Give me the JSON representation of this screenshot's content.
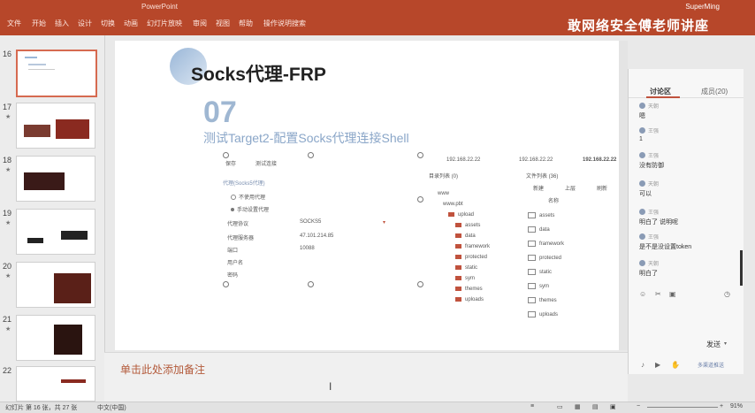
{
  "app": {
    "title_text": "PowerPoint",
    "user_text": "SuperMing"
  },
  "watermark": "敢网络安全傅老师讲座",
  "ribbon": {
    "tabs": [
      "文件",
      "开始",
      "插入",
      "设计",
      "切换",
      "动画",
      "幻灯片放映",
      "审阅",
      "视图",
      "帮助",
      "操作说明搜索"
    ]
  },
  "thumbnails": [
    {
      "num": "16",
      "star": "",
      "active": true
    },
    {
      "num": "17",
      "star": "★",
      "active": false
    },
    {
      "num": "18",
      "star": "★",
      "active": false
    },
    {
      "num": "19",
      "star": "★",
      "active": false
    },
    {
      "num": "20",
      "star": "★",
      "active": false
    },
    {
      "num": "21",
      "star": "★",
      "active": false
    },
    {
      "num": "22",
      "star": "",
      "active": false
    }
  ],
  "slide": {
    "title": "Socks代理-FRP",
    "number": "07",
    "subtitle": "测试Target2-配置Socks代理连接Shell"
  },
  "proxy_form": {
    "save": "保存",
    "test": "测试连接",
    "section": "代理(Socks5代理)",
    "no_proxy": "不使用代理",
    "manual_proxy": "手动设置代理",
    "protocol_label": "代理协议",
    "protocol_value": "SOCKS5",
    "server_label": "代理服务器",
    "server_value": "47.101.214.85",
    "port_label": "端口",
    "port_value": "10088",
    "user_label": "用户名",
    "pass_label": "密码"
  },
  "file_manager": {
    "tabs": [
      "192.168.22.22",
      "192.168.22.22",
      "192.168.22.22"
    ],
    "dir_list": "目录列表 (0)",
    "file_list": "文件列表 (36)",
    "new_btn": "新建",
    "up_btn": "上层",
    "refresh_btn": "刷新",
    "name_col": "名称",
    "tree": [
      "www",
      "www.pbt",
      "upload",
      "assets",
      "data",
      "framework",
      "protected",
      "static",
      "sym",
      "themes",
      "uploads"
    ],
    "files": [
      "assets",
      "data",
      "framework",
      "protected",
      "static",
      "sym",
      "themes",
      "uploads"
    ]
  },
  "notes": {
    "placeholder": "单击此处添加备注"
  },
  "chat": {
    "tab_discuss": "讨论区",
    "tab_members": "成员(20)",
    "messages": [
      {
        "name": "天朝",
        "text": "嗯"
      },
      {
        "name": "王强",
        "text": "1"
      },
      {
        "name": "王强",
        "text": "没有防御"
      },
      {
        "name": "天朝",
        "text": "可以"
      },
      {
        "name": "王强",
        "text": "明白了 说明呢"
      },
      {
        "name": "王强",
        "text": "是不是没设置token"
      },
      {
        "name": "天朝",
        "text": "明白了"
      }
    ],
    "send": "发送",
    "bottom_text": "多渠道推送"
  },
  "status": {
    "slide_info": "幻灯片 第 16 张，共 27 张",
    "lang": "中文(中国)",
    "zoom": "91%"
  }
}
